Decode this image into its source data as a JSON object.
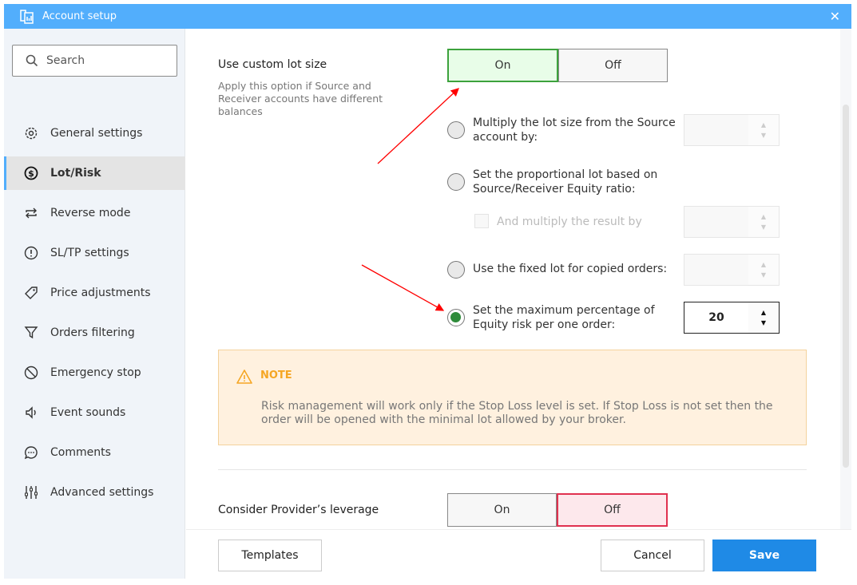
{
  "window": {
    "title": "Account setup"
  },
  "sidebar": {
    "search_placeholder": "Search",
    "items": [
      {
        "label": "General settings",
        "icon": "gear-icon"
      },
      {
        "label": "Lot/Risk",
        "icon": "dollar-circle-icon",
        "active": true
      },
      {
        "label": "Reverse mode",
        "icon": "repeat-icon"
      },
      {
        "label": "SL/TP settings",
        "icon": "alert-circle-icon"
      },
      {
        "label": "Price adjustments",
        "icon": "tag-icon"
      },
      {
        "label": "Orders filtering",
        "icon": "filter-icon"
      },
      {
        "label": "Emergency stop",
        "icon": "ban-icon"
      },
      {
        "label": "Event sounds",
        "icon": "speaker-icon"
      },
      {
        "label": "Comments",
        "icon": "chat-icon"
      },
      {
        "label": "Advanced settings",
        "icon": "sliders-icon"
      }
    ]
  },
  "custom_lot": {
    "label": "Use custom lot size",
    "description": "Apply this option if Source and Receiver accounts have different balances",
    "on": "On",
    "off": "Off",
    "selected": "On"
  },
  "options": [
    {
      "label": "Multiply the lot size from the Source account by:",
      "value": "",
      "selected": false
    },
    {
      "label": "Set the proportional lot based on Source/Receiver Equity ratio:",
      "selected": false
    },
    {
      "label": "Use the fixed lot for copied orders:",
      "value": "",
      "selected": false
    },
    {
      "label": "Set the maximum percentage of Equity risk per one order:",
      "value": "20",
      "selected": true
    }
  ],
  "multiply_result": {
    "label": "And multiply the result by",
    "checked": false,
    "value": ""
  },
  "note": {
    "title": "NOTE",
    "text": "Risk management will work only if the Stop Loss level is set. If Stop Loss is not set then the order will be opened with the minimal lot allowed by your broker."
  },
  "leverage": {
    "label": "Consider Provider’s leverage",
    "on": "On",
    "off": "Off",
    "selected": "Off"
  },
  "footer": {
    "templates": "Templates",
    "cancel": "Cancel",
    "save": "Save"
  },
  "colors": {
    "titlebar": "#52aefc",
    "on_selected": "#3ca23c",
    "off_selected": "#e0314f",
    "primary": "#1f8ae6",
    "note": "#f5a623",
    "annotation_arrow": "#ff0000"
  }
}
